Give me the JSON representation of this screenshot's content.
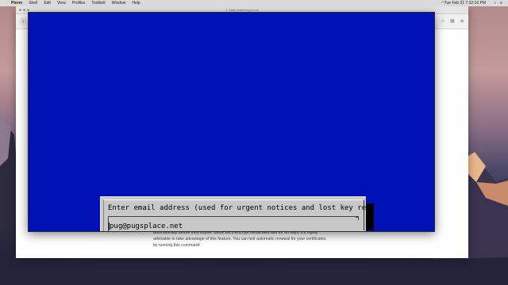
{
  "menubar": {
    "items": [
      "Pterm",
      "Shell",
      "Edit",
      "View",
      "Profiles",
      "Toolbelt",
      "Window",
      "Help"
    ],
    "clock": "Tue Feb 21  7:32:16 PM"
  },
  "browser": {
    "window_title": "1. bash-letsencrypt-tool",
    "page_lines": [
      "automatically before they expire. Since Let's Encrypt certificates last for 90 days, it's highly",
      "advisable to take advantage of this feature. You can test automatic renewal for your certificates",
      "by running this command:"
    ]
  },
  "terminal": {
    "dialog": {
      "prompt": "Enter email address (used for urgent notices and lost key recovery)",
      "input_value": "pug@pugsplace.net"
    }
  },
  "colors": {
    "terminal_bg": "#0011b6",
    "dialog_bg": "#c8c8c8"
  }
}
